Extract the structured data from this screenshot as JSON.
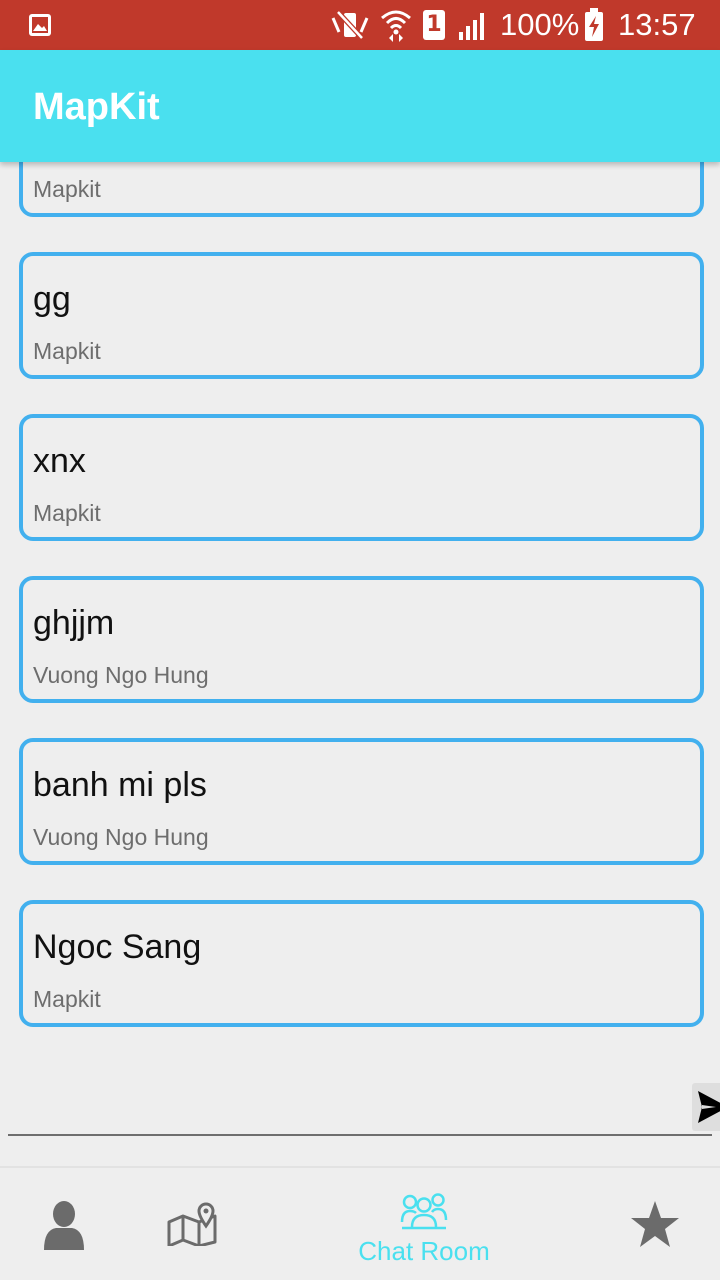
{
  "status_bar": {
    "sim_slot": "1",
    "battery_percent": "100%",
    "time": "13:57"
  },
  "app_bar": {
    "title": "MapKit"
  },
  "messages": [
    {
      "title": "",
      "sender": "Mapkit"
    },
    {
      "title": "gg",
      "sender": "Mapkit"
    },
    {
      "title": "xnx",
      "sender": "Mapkit"
    },
    {
      "title": "ghjjm",
      "sender": "Vuong Ngo Hung"
    },
    {
      "title": "banh mi pls",
      "sender": "Vuong Ngo Hung"
    },
    {
      "title": "Ngoc Sang",
      "sender": "Mapkit"
    }
  ],
  "bottom_nav": {
    "items": [
      {
        "icon": "person-icon",
        "label": "",
        "active": false
      },
      {
        "icon": "map-icon",
        "label": "",
        "active": false
      },
      {
        "icon": "chat-room-icon",
        "label": "Chat Room",
        "active": true
      },
      {
        "icon": "star-icon",
        "label": "",
        "active": false
      }
    ]
  },
  "colors": {
    "status_bar": "#c0392b",
    "app_bar": "#4ae0ef",
    "card_border": "#42b0ee",
    "active_tab": "#4ae0ef",
    "inactive_icon": "#6b6b6b"
  }
}
